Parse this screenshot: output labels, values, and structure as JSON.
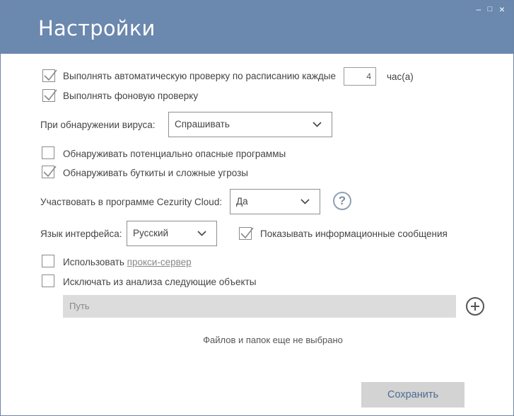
{
  "window": {
    "title": "Настройки",
    "controls": [
      "–",
      "□",
      "×"
    ]
  },
  "scan": {
    "auto_check_label": "Выполнять автоматическую проверку по расписанию каждые",
    "auto_check_checked": true,
    "interval_value": "4",
    "interval_unit": "час(а)",
    "background_check_label": "Выполнять фоновую проверку",
    "background_check_checked": true
  },
  "virus_action": {
    "label": "При обнаружении вируса:",
    "selected": "Спрашивать"
  },
  "detection": {
    "pup_label": "Обнаруживать потенциально опасные программы",
    "pup_checked": false,
    "bootkits_label": "Обнаруживать буткиты и сложные угрозы",
    "bootkits_checked": true
  },
  "cloud": {
    "label": "Участвовать в программе Cezurity Cloud:",
    "selected": "Да",
    "help_glyph": "?"
  },
  "language": {
    "label": "Язык интерфейса:",
    "selected": "Русский",
    "show_messages_label": "Показывать информационные сообщения",
    "show_messages_checked": true
  },
  "proxy": {
    "label": "Использовать",
    "link": "прокси-сервер",
    "checked": false
  },
  "exclusions": {
    "label": "Исключать из анализа следующие объекты",
    "checked": false,
    "path_placeholder": "Путь",
    "empty_text": "Файлов и папок еще не выбрано"
  },
  "footer": {
    "save_label": "Сохранить"
  },
  "colors": {
    "header": "#6b88ae",
    "accent_text": "#4a6b92",
    "button_bg": "#d3d3d3"
  }
}
